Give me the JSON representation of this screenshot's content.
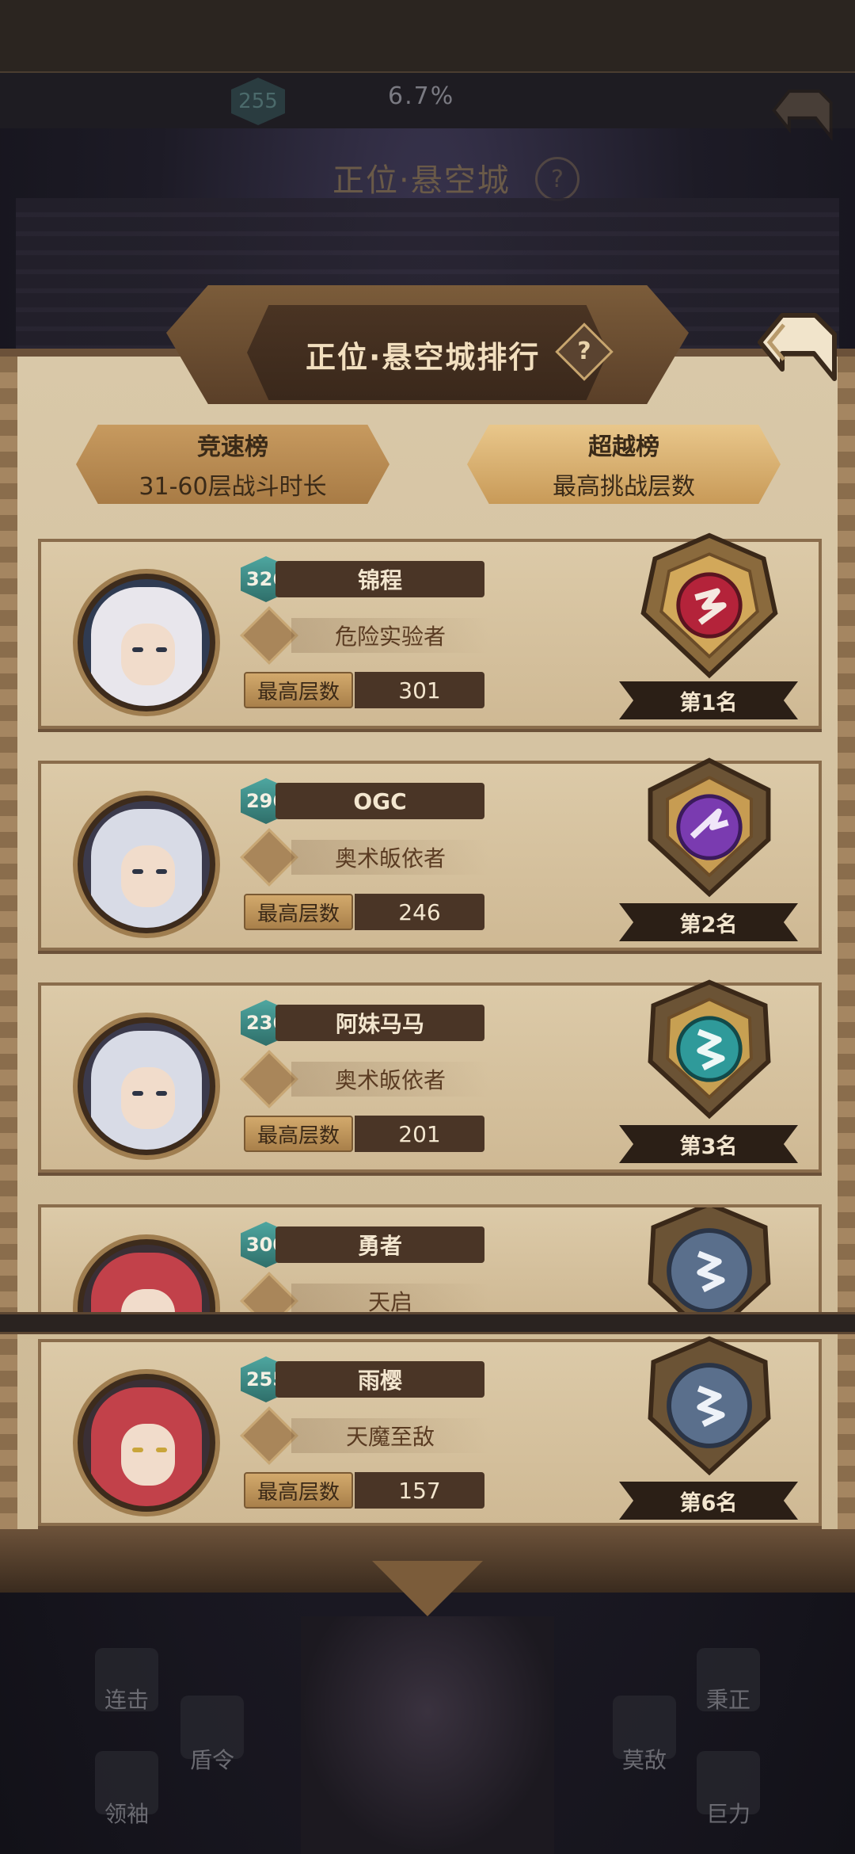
{
  "status": {
    "level": "255",
    "progress_text": "6.7%"
  },
  "bg_title": "正位·悬空城",
  "help_glyph": "?",
  "panel": {
    "title": "正位·悬空城排行",
    "tabs": [
      {
        "title": "竞速榜",
        "subtitle": "31-60层战斗时长"
      },
      {
        "title": "超越榜",
        "subtitle": "最高挑战层数"
      }
    ]
  },
  "rows": [
    {
      "level": "326",
      "name": "锦程",
      "title": "危险实验者",
      "stat_label": "最高层数",
      "stat_value": "301",
      "rank": "第1名",
      "badge_color": "#b4233a",
      "hair": "#e8e6ec"
    },
    {
      "level": "296",
      "name": "OGC",
      "title": "奥术皈依者",
      "stat_label": "最高层数",
      "stat_value": "246",
      "rank": "第2名",
      "badge_color": "#7a3bb0",
      "hair": "#d8dbe6"
    },
    {
      "level": "236",
      "name": "阿妹马马",
      "title": "奥术皈依者",
      "stat_label": "最高层数",
      "stat_value": "201",
      "rank": "第3名",
      "badge_color": "#2f9a9a",
      "hair": "#d8dbe6"
    },
    {
      "level": "300",
      "name": "勇者",
      "title": "天启",
      "badge_color": "#5a6f8c",
      "hair": "#c2414a"
    }
  ],
  "self_row": {
    "level": "255",
    "name": "雨樱",
    "title": "天魔至敌",
    "stat_label": "最高层数",
    "stat_value": "157",
    "rank": "第6名",
    "badge_color": "#5a6f8c",
    "hair": "#c2414a"
  },
  "bottom_skills": [
    "连击",
    "盾令",
    "领袖",
    "秉正",
    "莫敌",
    "巨力"
  ]
}
